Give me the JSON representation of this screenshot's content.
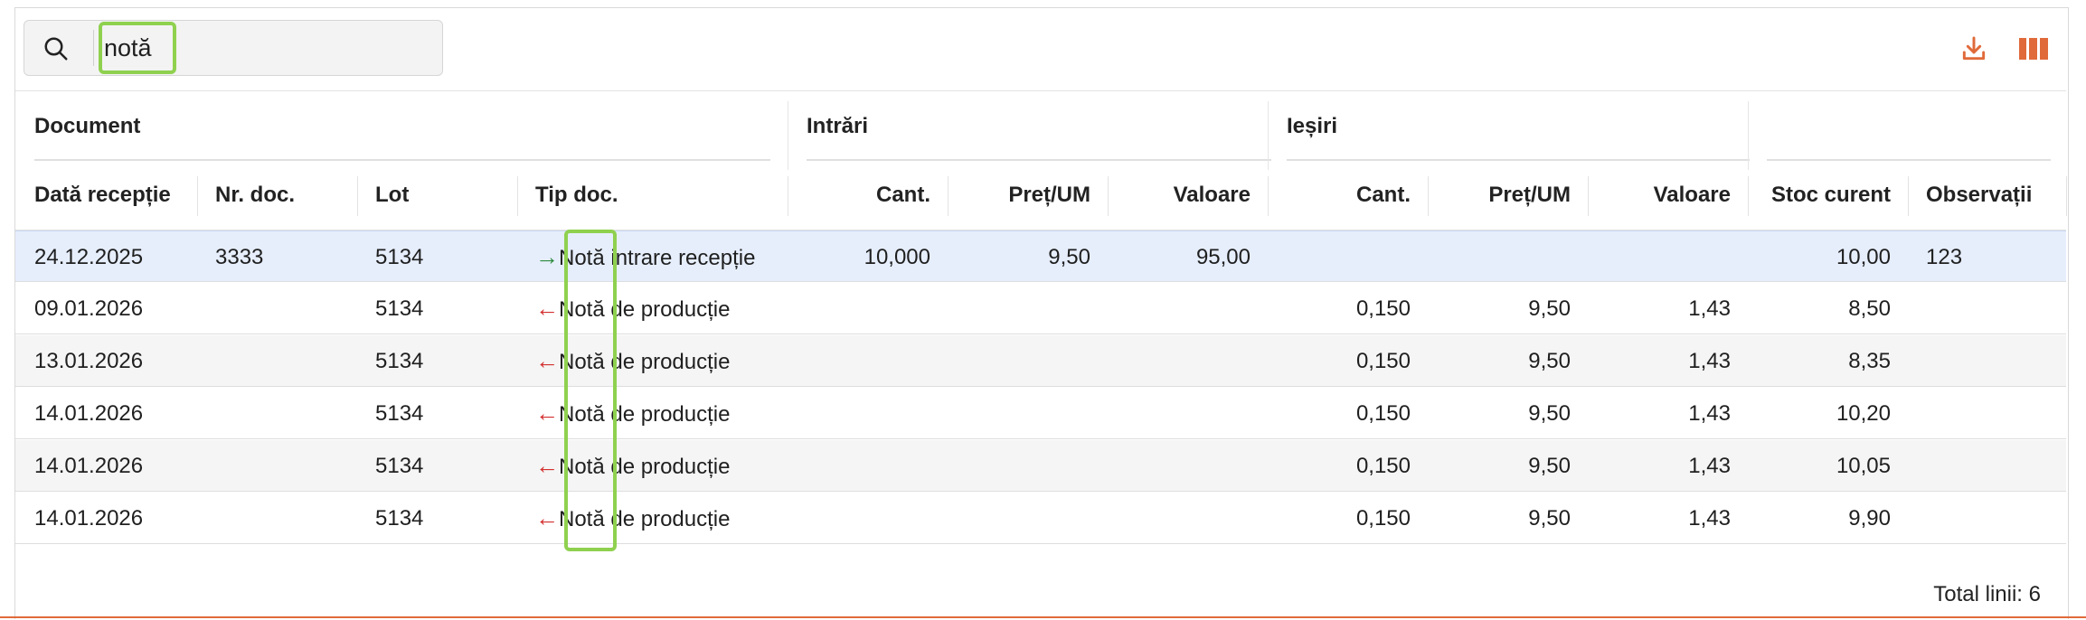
{
  "search": {
    "value": "notă",
    "placeholder": ""
  },
  "toolbar": {
    "download_icon": "download-icon",
    "columns_icon": "columns-icon",
    "accent": "#e06a3a"
  },
  "groups": {
    "document": "Document",
    "intrari": "Intrări",
    "iesiri": "Ieșiri"
  },
  "columns": {
    "data_receptie": "Dată recepție",
    "nr_doc": "Nr. doc.",
    "lot": "Lot",
    "tip_doc": "Tip doc.",
    "in_cant": "Cant.",
    "in_pret": "Preț/UM",
    "in_valoare": "Valoare",
    "out_cant": "Cant.",
    "out_pret": "Preț/UM",
    "out_valoare": "Valoare",
    "stoc_curent": "Stoc curent",
    "observatii": "Observații"
  },
  "rows": [
    {
      "data": "24.12.2025",
      "nr": "3333",
      "lot": "5134",
      "direction": "in",
      "tip_match": "Notă",
      "tip_rest": " intrare recepție",
      "in_cant": "10,000",
      "in_pret": "9,50",
      "in_valoare": "95,00",
      "out_cant": "",
      "out_pret": "",
      "out_valoare": "",
      "stoc": "10,00",
      "obs": "123"
    },
    {
      "data": "09.01.2026",
      "nr": "",
      "lot": "5134",
      "direction": "out",
      "tip_match": "Notă",
      "tip_rest": " de producție",
      "in_cant": "",
      "in_pret": "",
      "in_valoare": "",
      "out_cant": "0,150",
      "out_pret": "9,50",
      "out_valoare": "1,43",
      "stoc": "8,50",
      "obs": ""
    },
    {
      "data": "13.01.2026",
      "nr": "",
      "lot": "5134",
      "direction": "out",
      "tip_match": "Notă",
      "tip_rest": " de producție",
      "in_cant": "",
      "in_pret": "",
      "in_valoare": "",
      "out_cant": "0,150",
      "out_pret": "9,50",
      "out_valoare": "1,43",
      "stoc": "8,35",
      "obs": ""
    },
    {
      "data": "14.01.2026",
      "nr": "",
      "lot": "5134",
      "direction": "out",
      "tip_match": "Notă",
      "tip_rest": " de producție",
      "in_cant": "",
      "in_pret": "",
      "in_valoare": "",
      "out_cant": "0,150",
      "out_pret": "9,50",
      "out_valoare": "1,43",
      "stoc": "10,20",
      "obs": ""
    },
    {
      "data": "14.01.2026",
      "nr": "",
      "lot": "5134",
      "direction": "out",
      "tip_match": "Notă",
      "tip_rest": " de producție",
      "in_cant": "",
      "in_pret": "",
      "in_valoare": "",
      "out_cant": "0,150",
      "out_pret": "9,50",
      "out_valoare": "1,43",
      "stoc": "10,05",
      "obs": ""
    },
    {
      "data": "14.01.2026",
      "nr": "",
      "lot": "5134",
      "direction": "out",
      "tip_match": "Notă",
      "tip_rest": " de producție",
      "in_cant": "",
      "in_pret": "",
      "in_valoare": "",
      "out_cant": "0,150",
      "out_pret": "9,50",
      "out_valoare": "1,43",
      "stoc": "9,90",
      "obs": ""
    }
  ],
  "footer": {
    "total": "Total linii: 6"
  },
  "colors": {
    "in_arrow": "#2e8b3e",
    "out_arrow": "#d32f2f",
    "highlight": "#8fd14f",
    "selected_row": "#e6eefc"
  }
}
